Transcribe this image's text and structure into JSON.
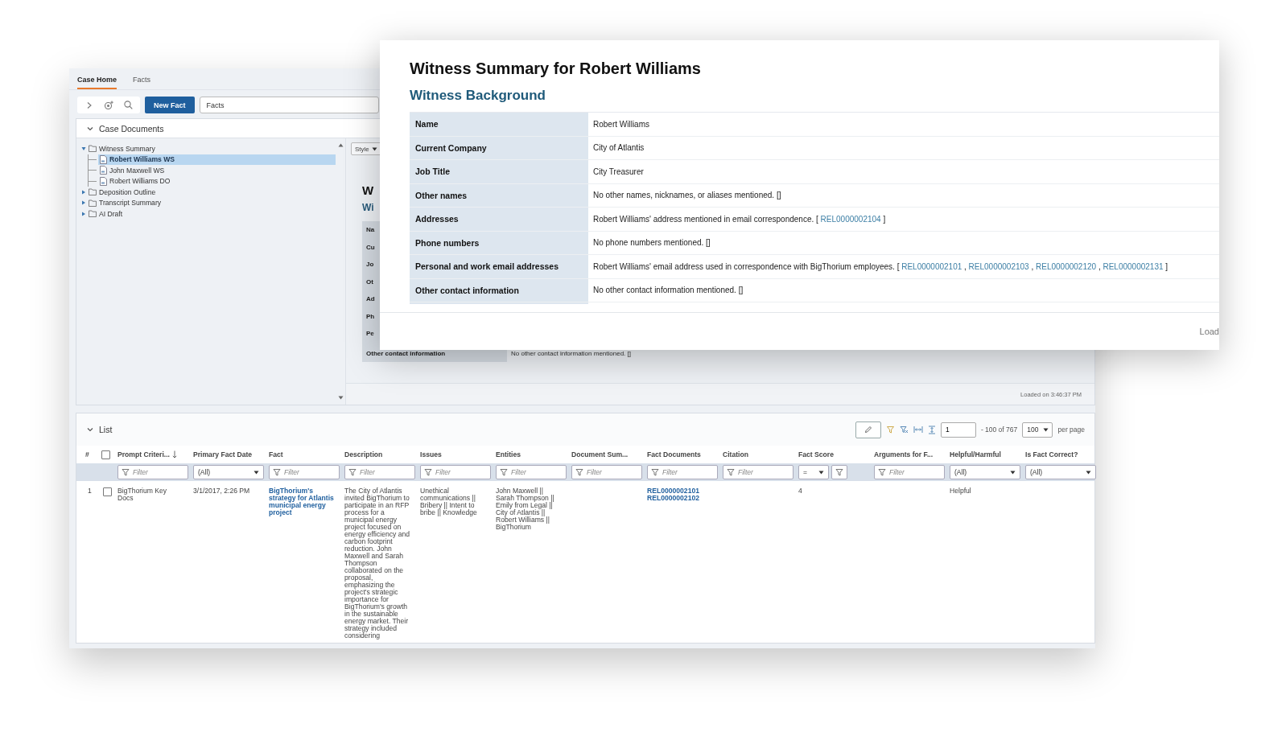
{
  "app": {
    "tabs": [
      {
        "label": "Case Home",
        "selected": true
      },
      {
        "label": "Facts",
        "selected": false
      }
    ],
    "toolbar": {
      "new_button": "New Fact",
      "search_value": "Facts"
    },
    "case_documents": {
      "title": "Case Documents",
      "expanded": true,
      "tree": [
        {
          "label": "Witness Summary",
          "kind": "folder",
          "expanded": true,
          "selected": false,
          "children": [
            {
              "label": "Robert Williams WS",
              "kind": "document",
              "selected": true
            },
            {
              "label": "John Maxwell WS",
              "kind": "document",
              "selected": false
            },
            {
              "label": "Robert Williams DO",
              "kind": "document",
              "selected": false
            }
          ]
        },
        {
          "label": "Deposition Outline",
          "kind": "folder",
          "expanded": false,
          "selected": false
        },
        {
          "label": "Transcript Summary",
          "kind": "folder",
          "expanded": false,
          "selected": false
        },
        {
          "label": "AI Draft",
          "kind": "folder",
          "expanded": false,
          "selected": false
        }
      ],
      "preview": {
        "style_button": "Style",
        "title": "W",
        "subtitle": "Wi",
        "stub_labels": [
          "Na",
          "Cu",
          "Jo",
          "Ot",
          "Ad",
          "Ph",
          "Pe"
        ],
        "rows": [
          {
            "label": "Other contact information",
            "value": "No other contact information mentioned. []"
          }
        ],
        "status": "Loaded on 3:46:37 PM"
      }
    },
    "list": {
      "title": "List",
      "expanded": true,
      "pager": {
        "page": "1",
        "range": "- 100 of 767",
        "per_page": "100",
        "per_page_label": "per page"
      },
      "index_label": "#",
      "select_all": {
        "checked": false
      },
      "columns": [
        {
          "label": "Prompt Criteri...",
          "sorted": true,
          "filter": {
            "kind": "text",
            "placeholder": "Filter"
          }
        },
        {
          "label": "Primary Fact Date",
          "sorted": false,
          "filter": {
            "kind": "select",
            "value": "(All)"
          }
        },
        {
          "label": "Fact",
          "sorted": false,
          "filter": {
            "kind": "text",
            "placeholder": "Filter"
          }
        },
        {
          "label": "Description",
          "sorted": false,
          "filter": {
            "kind": "text",
            "placeholder": "Filter"
          }
        },
        {
          "label": "Issues",
          "sorted": false,
          "filter": {
            "kind": "text",
            "placeholder": "Filter"
          }
        },
        {
          "label": "Entities",
          "sorted": false,
          "filter": {
            "kind": "text",
            "placeholder": "Filter"
          }
        },
        {
          "label": "Document Sum...",
          "sorted": false,
          "filter": {
            "kind": "text",
            "placeholder": "Filter"
          }
        },
        {
          "label": "Fact Documents",
          "sorted": false,
          "filter": {
            "kind": "text",
            "placeholder": "Filter"
          }
        },
        {
          "label": "Citation",
          "sorted": false,
          "filter": {
            "kind": "text",
            "placeholder": "Filter"
          }
        },
        {
          "label": "Fact Score",
          "sorted": false,
          "filter": {
            "kind": "operator",
            "value": "="
          }
        },
        {
          "label": "Arguments for F...",
          "sorted": false,
          "filter": {
            "kind": "text",
            "placeholder": "Filter"
          }
        },
        {
          "label": "Helpful/Harmful",
          "sorted": false,
          "filter": {
            "kind": "select",
            "value": "(All)"
          }
        },
        {
          "label": "Is Fact Correct?",
          "sorted": false,
          "filter": {
            "kind": "select",
            "value": "(All)"
          }
        }
      ],
      "rows": [
        {
          "number": "1",
          "checked": false,
          "cells": [
            {
              "kind": "text",
              "text": "BigThorium Key Docs"
            },
            {
              "kind": "text",
              "text": "3/1/2017, 2:26 PM"
            },
            {
              "kind": "link",
              "text": "BigThorium's strategy for Atlantis municipal energy project"
            },
            {
              "kind": "text",
              "text": "The City of Atlantis invited BigThorium to participate in an RFP process for a municipal energy project focused on energy efficiency and carbon footprint reduction. John Maxwell and Sarah Thompson collaborated on the proposal, emphasizing the project's strategic importance for BigThorium's growth in the sustainable energy market. Their strategy included considering"
            },
            {
              "kind": "text",
              "text": "Unethical communications || Bribery || Intent to bribe || Knowledge"
            },
            {
              "kind": "text",
              "text": "John Maxwell || Sarah Thompson || Emily from Legal || City of Atlantis || Robert Williams || BigThorium"
            },
            {
              "kind": "empty"
            },
            {
              "kind": "links",
              "items": [
                "REL0000002101",
                "REL0000002102"
              ]
            },
            {
              "kind": "empty"
            },
            {
              "kind": "text",
              "text": "4"
            },
            {
              "kind": "empty"
            },
            {
              "kind": "text",
              "text": "Helpful"
            },
            {
              "kind": "empty"
            }
          ]
        }
      ]
    }
  },
  "summary_window": {
    "title": "Witness Summary for Robert Williams",
    "section": "Witness Background",
    "rows": [
      {
        "label": "Name",
        "value": [
          {
            "kind": "text",
            "text": "Robert Williams"
          }
        ]
      },
      {
        "label": "Current Company",
        "value": [
          {
            "kind": "text",
            "text": "City of Atlantis"
          }
        ]
      },
      {
        "label": "Job Title",
        "value": [
          {
            "kind": "text",
            "text": "City Treasurer"
          }
        ]
      },
      {
        "label": "Other names",
        "value": [
          {
            "kind": "text",
            "text": "No other names, nicknames, or aliases mentioned. []"
          }
        ]
      },
      {
        "label": "Addresses",
        "value": [
          {
            "kind": "text",
            "text": "Robert Williams' address mentioned in email correspondence. ["
          },
          {
            "kind": "link",
            "text": "REL0000002104"
          },
          {
            "kind": "text",
            "text": "]"
          }
        ]
      },
      {
        "label": "Phone numbers",
        "value": [
          {
            "kind": "text",
            "text": "No phone numbers mentioned. []"
          }
        ]
      },
      {
        "label": "Personal and work email addresses",
        "value": [
          {
            "kind": "text",
            "text": "Robert Williams' email address used in correspondence with BigThorium employees. ["
          },
          {
            "kind": "link",
            "text": "REL0000002101"
          },
          {
            "kind": "text",
            "text": ","
          },
          {
            "kind": "link",
            "text": "REL0000002103"
          },
          {
            "kind": "text",
            "text": ","
          },
          {
            "kind": "link",
            "text": "REL0000002120"
          },
          {
            "kind": "text",
            "text": ","
          },
          {
            "kind": "link",
            "text": "REL0000002131"
          },
          {
            "kind": "text",
            "text": "]"
          }
        ]
      },
      {
        "label": "Other contact information",
        "value": [
          {
            "kind": "text",
            "text": "No other contact information mentioned. []"
          }
        ]
      }
    ],
    "status": "Load"
  }
}
